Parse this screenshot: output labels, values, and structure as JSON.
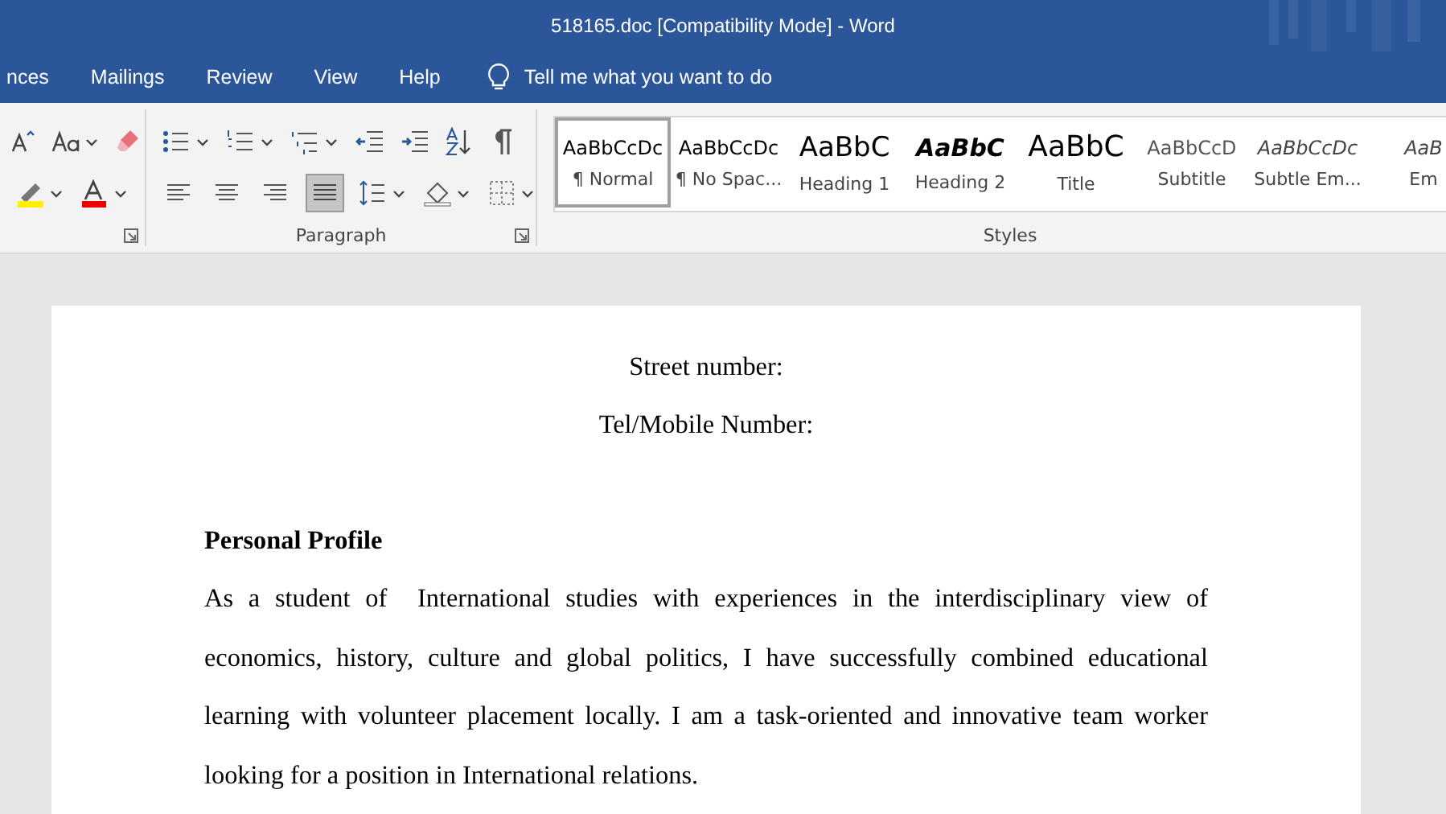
{
  "window": {
    "title": "518165.doc [Compatibility Mode]  -  Word"
  },
  "tabs": [
    {
      "label": "nces",
      "selected": false
    },
    {
      "label": "Mailings",
      "selected": false
    },
    {
      "label": "Review",
      "selected": false
    },
    {
      "label": "View",
      "selected": false
    },
    {
      "label": "Help",
      "selected": false
    }
  ],
  "tell_me": {
    "placeholder": "Tell me what you want to do"
  },
  "ribbon": {
    "paragraph_group": {
      "label": "Paragraph",
      "justify_selected": true
    },
    "styles_group": {
      "label": "Styles",
      "styles": [
        {
          "sample": "AaBbCcDc",
          "name": "¶ Normal",
          "kind": "normal",
          "selected": true
        },
        {
          "sample": "AaBbCcDc",
          "name": "¶ No Spac...",
          "kind": "normal",
          "selected": false
        },
        {
          "sample": "AaBbC",
          "name": "Heading 1",
          "kind": "heading",
          "selected": false
        },
        {
          "sample": "AaBbC",
          "name": "Heading 2",
          "kind": "italic-heading",
          "selected": false
        },
        {
          "sample": "AaBbC",
          "name": "Title",
          "kind": "title",
          "selected": false
        },
        {
          "sample": "AaBbCcD",
          "name": "Subtitle",
          "kind": "subtitle",
          "selected": false
        },
        {
          "sample": "AaBbCcDc",
          "name": "Subtle Em...",
          "kind": "emphasis",
          "selected": false
        },
        {
          "sample": "AaB",
          "name": "Em",
          "kind": "emphasis",
          "selected": false
        }
      ]
    }
  },
  "document": {
    "centered_lines": [
      "Street number:",
      "Tel/Mobile Number:"
    ],
    "heading": "Personal Profile",
    "paragraph": "As a student of  International studies with experiences in the interdisciplinary view of economics, history, culture and global politics, I have successfully combined educational learning with volunteer placement locally. I am a task-oriented and innovative team worker looking for a position in International relations."
  }
}
